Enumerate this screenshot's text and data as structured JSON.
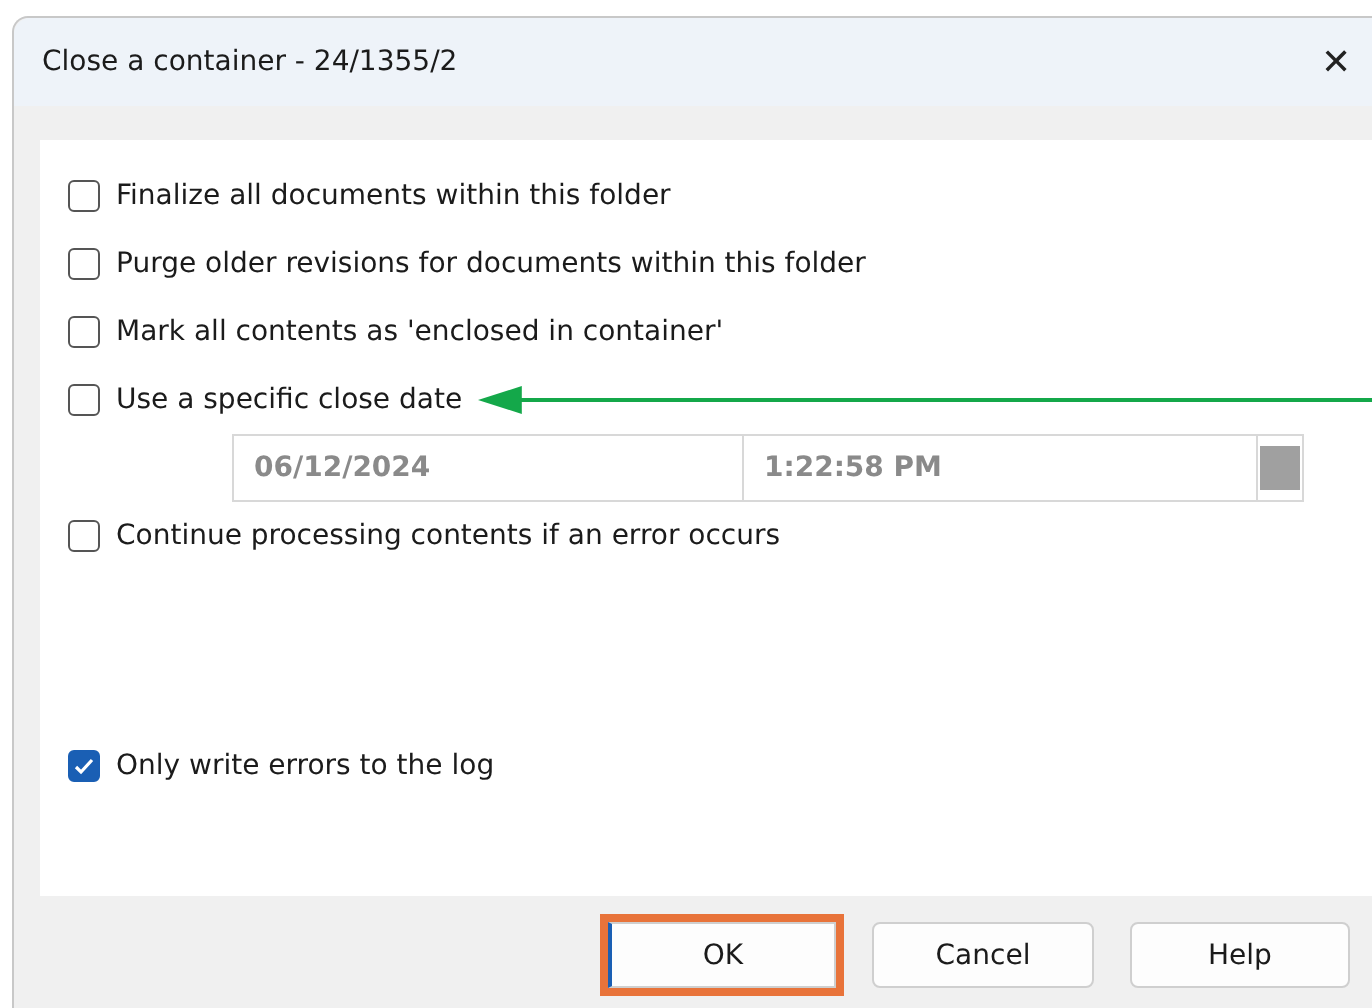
{
  "window": {
    "title": "Close a container - 24/1355/2",
    "close": "✕"
  },
  "options": [
    {
      "kind": "checkbox",
      "label": "Finalize all documents within this folder",
      "checked": false
    },
    {
      "kind": "checkbox",
      "label": "Purge older revisions for documents within this folder",
      "checked": false
    },
    {
      "kind": "checkbox",
      "label": "Mark all contents as 'enclosed in container'",
      "checked": false
    },
    {
      "kind": "checkbox",
      "label": "Use a specific close date",
      "checked": false,
      "arrow": true
    },
    {
      "kind": "datetime",
      "date": "06/12/2024",
      "time": "1:22:58 PM",
      "disabled": true
    },
    {
      "kind": "checkbox",
      "label": "Continue processing contents if an error occurs",
      "checked": false
    },
    {
      "kind": "spacer"
    },
    {
      "kind": "checkbox",
      "label": "Only write errors to the log",
      "checked": true
    }
  ],
  "buttons": [
    {
      "label": "OK",
      "highlighted": true
    },
    {
      "label": "Cancel",
      "highlighted": false
    },
    {
      "label": "Help",
      "highlighted": false
    }
  ]
}
